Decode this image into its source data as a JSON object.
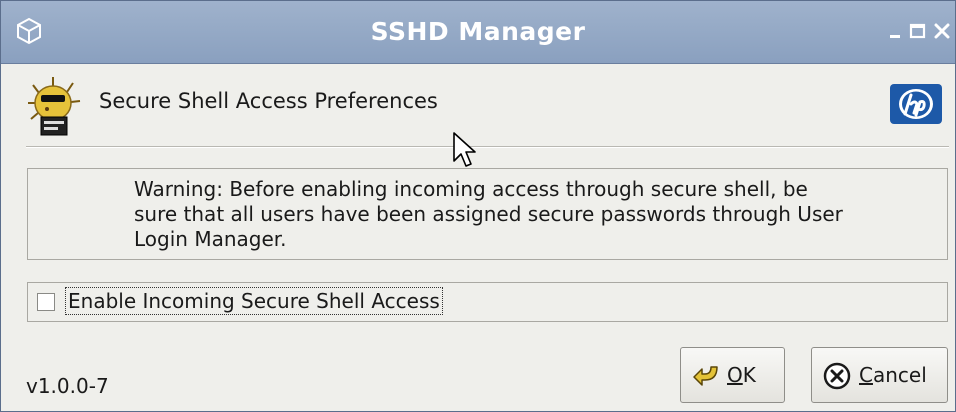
{
  "window": {
    "title": "SSHD Manager",
    "title_icon": "cube-icon",
    "controls": [
      "minimize-icon",
      "maximize-icon",
      "close-icon"
    ]
  },
  "header": {
    "logo_icon": "pufferfish-icon",
    "title": "Secure Shell Access Preferences",
    "brand_icon": "hp-logo-icon"
  },
  "warning": {
    "text": "Warning:  Before enabling incoming access through secure shell, be sure that all users have been assigned secure passwords through User Login Manager."
  },
  "options": {
    "enable_ssh_label": "Enable Incoming Secure Shell Access",
    "enable_ssh_checked": false
  },
  "footer": {
    "version": "v1.0.0-7",
    "ok_label": "OK",
    "ok_icon": "ok-arrow-icon",
    "cancel_label": "Cancel",
    "cancel_icon": "cancel-circle-icon"
  },
  "colors": {
    "titlebar": "#8aa0bf",
    "window_bg": "#efefeb",
    "text": "#1a1a1a"
  }
}
